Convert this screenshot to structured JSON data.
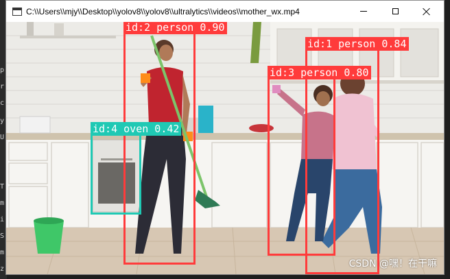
{
  "window": {
    "title": "C:\\\\Users\\\\mjy\\\\Desktop\\\\yolov8\\\\yolov8\\\\ultralytics\\\\videos\\\\mother_wx.mp4"
  },
  "detections": [
    {
      "label": "id:2 person 0.90",
      "color": "#ff3b3b"
    },
    {
      "label": "id:1 person 0.84",
      "color": "#ff3b3b"
    },
    {
      "label": "id:3 person 0.80",
      "color": "#ff3b3b"
    },
    {
      "label": "id:4 oven 0.42",
      "color": "#1fc9b4"
    }
  ],
  "watermark": "CSDN @嘿！在干嘛",
  "left_strip_chars": [
    "p",
    "r",
    "c",
    "y",
    "U",
    "T",
    "m",
    "i",
    "S",
    "m",
    "z"
  ]
}
